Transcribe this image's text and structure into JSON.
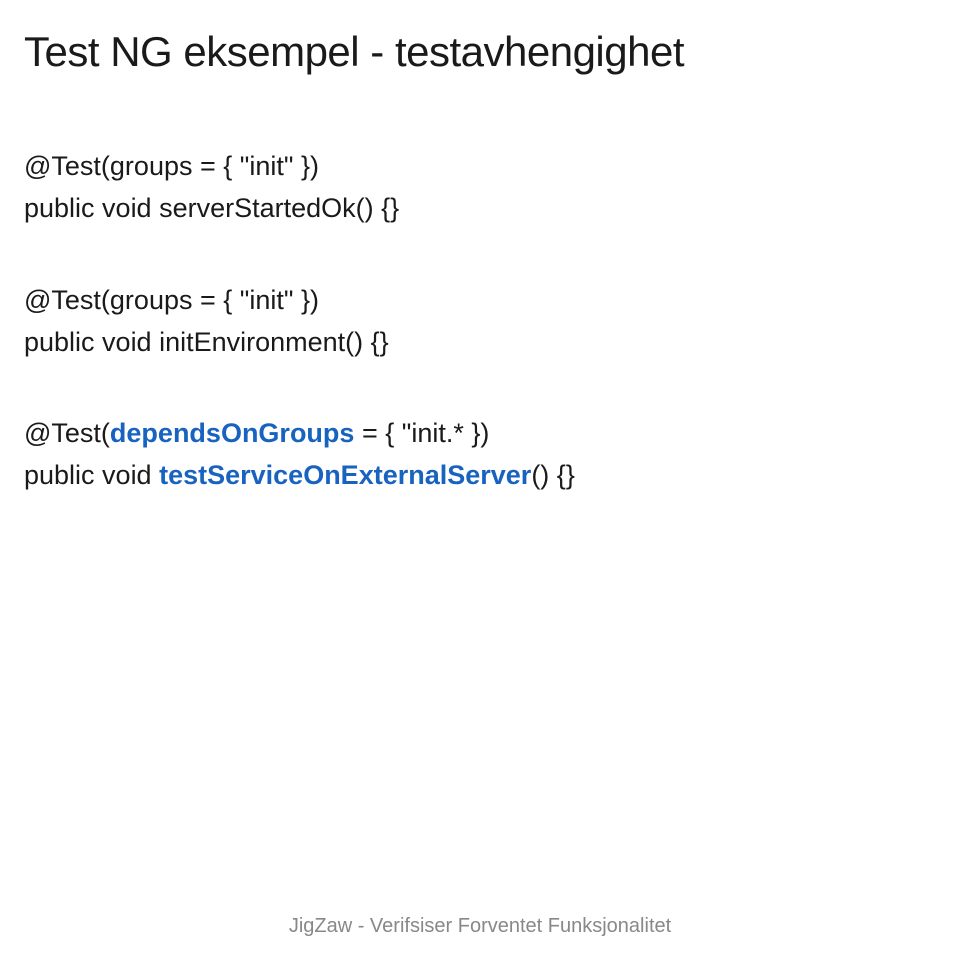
{
  "title": "Test NG eksempel - testavhengighet",
  "code1": {
    "line1": "@Test(groups = { \"init\" })",
    "line2": "public void serverStartedOk() {}"
  },
  "code2": {
    "line1": "@Test(groups = { \"init\" })",
    "line2": "public void initEnvironment() {}"
  },
  "code3": {
    "prefix": "@Test(",
    "highlight1": "dependsOnGroups",
    "mid": " = { \"init.* })",
    "line2_prefix": "public void ",
    "highlight2": "testServiceOnExternalServer",
    "line2_suffix": "() {}"
  },
  "footer": "JigZaw - Verifsiser Forventet Funksjonalitet"
}
